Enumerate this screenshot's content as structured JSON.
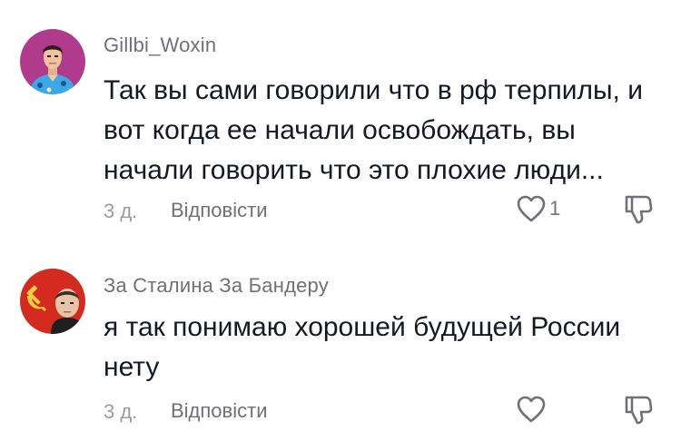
{
  "comments": [
    {
      "username": "Gillbi_Woxin",
      "lines": [
        "Так вы сами говорили что в рф терпилы, и",
        "вот когда ее начали освобождать, вы",
        "начали говорить что это плохие люди..."
      ],
      "time": "3 д.",
      "reply_label": "Відповісти",
      "likes": "1",
      "avatar_icon": "man-in-hawaiian-shirt-avatar",
      "avatar_bg": "#b03a8c"
    },
    {
      "username": "За Сталина За Бандеру",
      "lines": [
        "я так понимаю хорошей будущей России",
        "нету"
      ],
      "time": "3 д.",
      "reply_label": "Відповісти",
      "likes": "",
      "avatar_icon": "hammer-sickle-portrait-avatar",
      "avatar_bg": "#d42a1f"
    }
  ],
  "icons": {
    "like": "heart-outline-icon",
    "dislike": "thumbs-down-outline-icon"
  },
  "colors": {
    "text": "#161823",
    "secondary": "#6f7078",
    "time": "#9a9ba1"
  }
}
